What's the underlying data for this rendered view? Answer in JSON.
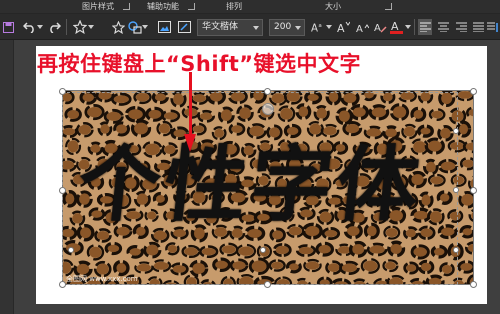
{
  "ribbon": {
    "groups": [
      "图片样式",
      "辅助功能",
      "排列",
      "大小"
    ]
  },
  "toolbar": {
    "font_name": "华文楷体",
    "font_size": "200",
    "font_color": "#e02020",
    "buttons": [
      "save-icon",
      "undo-icon",
      "redo-icon",
      "shape-star-icon",
      "shape-star-outline-icon",
      "shape-group-icon",
      "image-icon",
      "picture-edit-icon",
      "grow-font-icon",
      "shrink-font-icon",
      "font-case-icon",
      "clear-format-icon",
      "font-color-icon",
      "align-left-icon",
      "align-center-icon",
      "align-right-icon",
      "justify-icon",
      "text-direction-icon"
    ]
  },
  "slide": {
    "annotation": "再按住键盘上“Shift”键选中文字",
    "big_text": "个性字体",
    "watermark": "全图网 www.xxx.com"
  },
  "colors": {
    "annotation": "#e8102a",
    "ribbon_bg": "#2b2b2b"
  }
}
